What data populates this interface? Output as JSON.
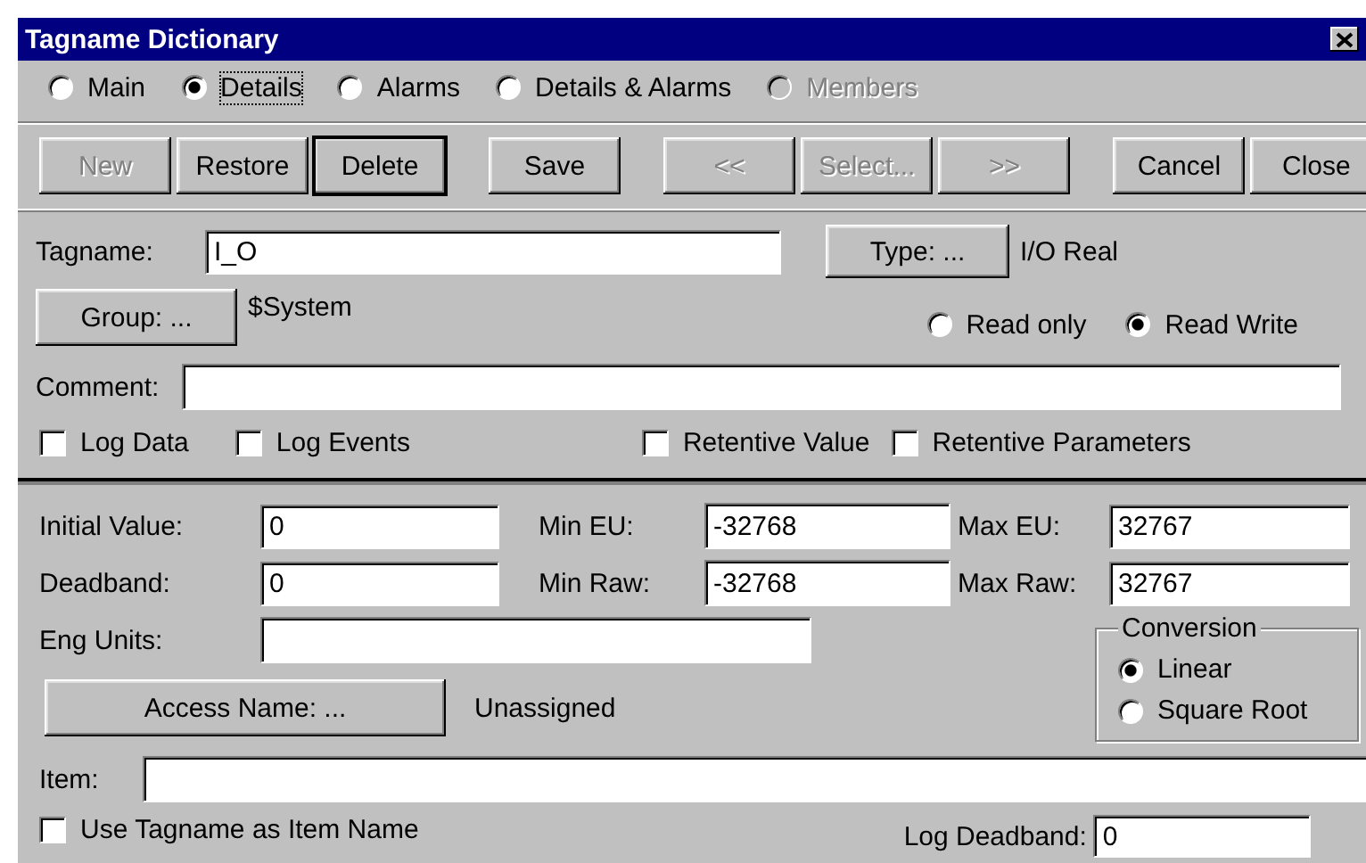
{
  "window": {
    "title": "Tagname Dictionary"
  },
  "view_options": [
    {
      "label": "Main",
      "selected": false,
      "focused": false,
      "disabled": false
    },
    {
      "label": "Details",
      "selected": true,
      "focused": true,
      "disabled": false
    },
    {
      "label": "Alarms",
      "selected": false,
      "focused": false,
      "disabled": false
    },
    {
      "label": "Details & Alarms",
      "selected": false,
      "focused": false,
      "disabled": false
    },
    {
      "label": "Members",
      "selected": false,
      "focused": false,
      "disabled": true
    }
  ],
  "button_groups": [
    [
      {
        "label": "New",
        "disabled": true,
        "default": false
      },
      {
        "label": "Restore",
        "disabled": false,
        "default": false
      },
      {
        "label": "Delete",
        "disabled": false,
        "default": true
      }
    ],
    [
      {
        "label": "Save",
        "disabled": false,
        "default": false
      }
    ],
    [
      {
        "label": "<<",
        "disabled": true,
        "default": false
      },
      {
        "label": "Select...",
        "disabled": true,
        "default": false
      },
      {
        "label": ">>",
        "disabled": true,
        "default": false
      }
    ],
    [
      {
        "label": "Cancel",
        "disabled": false,
        "default": false
      },
      {
        "label": "Close",
        "disabled": false,
        "default": false
      }
    ]
  ],
  "tagname": {
    "label": "Tagname:",
    "value": "I_O"
  },
  "type": {
    "button": "Type: ...",
    "value": "I/O Real"
  },
  "group": {
    "button": "Group: ...",
    "value": "$System"
  },
  "access": [
    {
      "label": "Read only",
      "selected": false
    },
    {
      "label": "Read Write",
      "selected": true
    }
  ],
  "comment": {
    "label": "Comment:"
  },
  "options": [
    {
      "label": "Log Data",
      "checked": false
    },
    {
      "label": "Log Events",
      "checked": false
    },
    {
      "label": "Retentive Value",
      "checked": false
    },
    {
      "label": "Retentive Parameters",
      "checked": false
    }
  ],
  "fields": [
    [
      {
        "label": "Initial Value:",
        "value": "0"
      },
      {
        "label": "Min EU:",
        "value": "-32768"
      },
      {
        "label": "Max EU:",
        "value": "32767"
      }
    ],
    [
      {
        "label": "Deadband:",
        "value": "0"
      },
      {
        "label": "Min Raw:",
        "value": "-32768"
      },
      {
        "label": "Max Raw:",
        "value": "32767"
      }
    ]
  ],
  "eng_units": {
    "label": "Eng Units:"
  },
  "conversion": {
    "title": "Conversion",
    "options": [
      {
        "label": "Linear",
        "selected": true
      },
      {
        "label": "Square Root",
        "selected": false
      }
    ]
  },
  "access_name": {
    "button": "Access Name: ...",
    "value": "Unassigned"
  },
  "item": {
    "label": "Item:"
  },
  "use_tagname": {
    "label": "Use Tagname as Item Name",
    "checked": false
  },
  "log_deadband": {
    "label": "Log Deadband:",
    "value": "0"
  }
}
